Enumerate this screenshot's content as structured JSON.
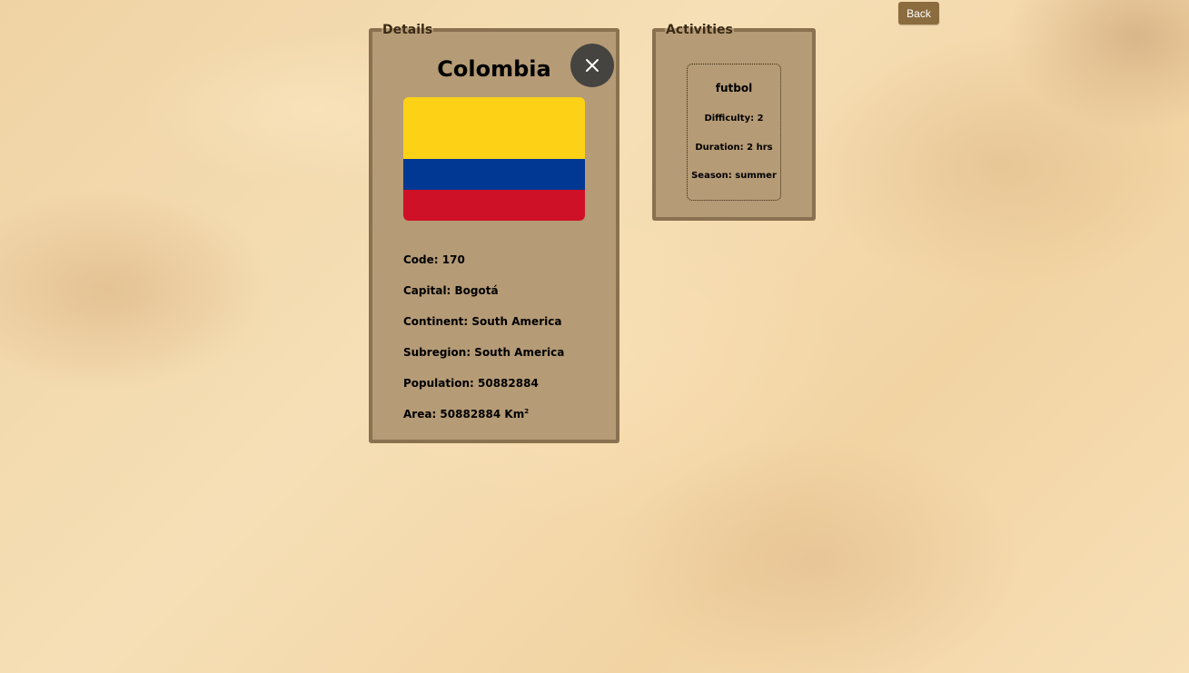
{
  "header": {
    "back_label": "Back"
  },
  "details": {
    "legend": "Details",
    "name": "Colombia",
    "flag_colors": [
      "#fcd116",
      "#003893",
      "#ce1126"
    ],
    "fields": {
      "code": "Code: 170",
      "capital": "Capital: Bogotá",
      "continent": "Continent: South America",
      "subregion": "Subregion: South America",
      "population": "Population: 50882884",
      "area": "Area: 50882884 Km",
      "area_superscript": "2"
    },
    "close_icon": "close-icon"
  },
  "activities": {
    "legend": "Activities",
    "items": [
      {
        "name": "futbol",
        "difficulty": "Difficulty: 2",
        "duration": "Duration: 2 hrs",
        "season": "Season: summer"
      }
    ]
  },
  "colors": {
    "panel_bg": "#b59b76",
    "panel_border": "#8a714f",
    "back_button": "#8b6c3f",
    "close_button": "#454441"
  }
}
